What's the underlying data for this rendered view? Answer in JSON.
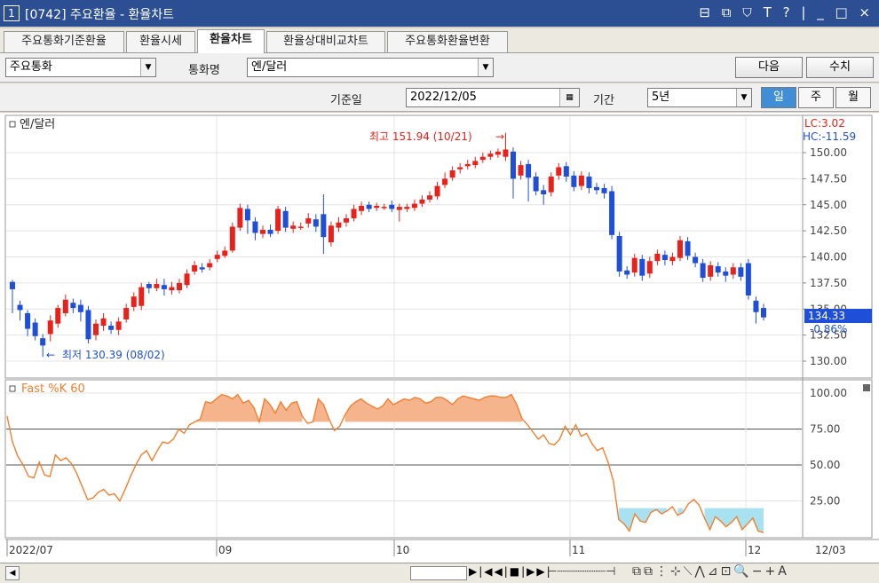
{
  "window": {
    "number": "1",
    "title": "[0742] 주요환율 - 환율차트",
    "controls": "⊟ ⧉ ⛉ T ? | _ □ ×"
  },
  "tabs": [
    "주요통화기준환율",
    "환율시세",
    "환율차트",
    "환율상대비교차트",
    "주요통화환율변환"
  ],
  "active_tab": "환율차트",
  "filters": {
    "group_value": "주요통화",
    "currency_label": "통화명",
    "currency_value": "엔/달러",
    "next_button": "다음",
    "refresh_button": "수치",
    "date_label": "기준일",
    "date_value": "2022/12/05",
    "period_label": "기간",
    "period_value": "5년",
    "day_button": "일",
    "week_button": "주",
    "month_button": "월"
  },
  "colors": {
    "up": "#e8221b",
    "down": "#1f4fd8",
    "fastk": "#f08030",
    "fill_high": "#f5b48c",
    "fill_low": "#a8e2f0",
    "current_badge": "#1f4fd8"
  },
  "price_panel": {
    "name": "엔/달러",
    "lc": "LC:3.02",
    "hc": "HC:-11.59",
    "high_note": "최고 151.94 (10/21)",
    "low_note": "최저 130.39 (08/02)",
    "current_value": "134.33",
    "current_change": "-0.86%",
    "y_ticks": [
      "150.00",
      "147.50",
      "145.00",
      "142.50",
      "140.00",
      "137.50",
      "135.00",
      "132.50",
      "130.00"
    ]
  },
  "osc_panel": {
    "name": "Fast %K 60",
    "y_ticks": [
      "100.00",
      "75.00",
      "50.00",
      "25.00"
    ]
  },
  "x_axis": {
    "labels": [
      "2022/07",
      "09",
      "10",
      "11",
      "12",
      "12/03"
    ]
  },
  "chart_data": {
    "type": "candlestick",
    "title": "엔/달러",
    "ylim": [
      129,
      152
    ],
    "candles": [
      {
        "o": 137.6,
        "c": 136.9,
        "h": 137.8,
        "l": 134.6,
        "up": false
      },
      {
        "o": 135.4,
        "c": 134.9,
        "h": 135.8,
        "l": 133.9,
        "up": false
      },
      {
        "o": 134.6,
        "c": 133.1,
        "h": 134.9,
        "l": 132.4,
        "up": false
      },
      {
        "o": 133.7,
        "c": 132.4,
        "h": 134.1,
        "l": 132.0,
        "up": false
      },
      {
        "o": 132.2,
        "c": 131.5,
        "h": 132.6,
        "l": 130.4,
        "up": false
      },
      {
        "o": 132.6,
        "c": 133.9,
        "h": 134.4,
        "l": 131.9,
        "up": true
      },
      {
        "o": 133.6,
        "c": 135.1,
        "h": 135.4,
        "l": 133.2,
        "up": true
      },
      {
        "o": 134.6,
        "c": 135.9,
        "h": 136.4,
        "l": 134.3,
        "up": true
      },
      {
        "o": 135.6,
        "c": 135.1,
        "h": 136.0,
        "l": 134.6,
        "up": false
      },
      {
        "o": 135.4,
        "c": 134.7,
        "h": 135.9,
        "l": 133.8,
        "up": false
      },
      {
        "o": 134.9,
        "c": 132.1,
        "h": 135.3,
        "l": 131.7,
        "up": false
      },
      {
        "o": 132.5,
        "c": 133.6,
        "h": 134.0,
        "l": 132.0,
        "up": true
      },
      {
        "o": 133.4,
        "c": 134.1,
        "h": 134.6,
        "l": 132.9,
        "up": true
      },
      {
        "o": 133.4,
        "c": 133.0,
        "h": 133.8,
        "l": 132.6,
        "up": false
      },
      {
        "o": 133.0,
        "c": 133.8,
        "h": 134.2,
        "l": 132.5,
        "up": true
      },
      {
        "o": 134.0,
        "c": 135.1,
        "h": 135.5,
        "l": 133.7,
        "up": true
      },
      {
        "o": 135.2,
        "c": 136.2,
        "h": 136.6,
        "l": 134.8,
        "up": true
      },
      {
        "o": 135.3,
        "c": 137.1,
        "h": 137.5,
        "l": 134.9,
        "up": true
      },
      {
        "o": 137.4,
        "c": 137.0,
        "h": 137.6,
        "l": 136.5,
        "up": false
      },
      {
        "o": 137.0,
        "c": 137.4,
        "h": 137.9,
        "l": 136.7,
        "up": true
      },
      {
        "o": 137.3,
        "c": 136.9,
        "h": 137.9,
        "l": 136.3,
        "up": false
      },
      {
        "o": 136.8,
        "c": 137.1,
        "h": 137.6,
        "l": 136.4,
        "up": true
      },
      {
        "o": 136.8,
        "c": 137.5,
        "h": 137.9,
        "l": 136.5,
        "up": true
      },
      {
        "o": 137.3,
        "c": 138.4,
        "h": 138.8,
        "l": 137.0,
        "up": true
      },
      {
        "o": 138.6,
        "c": 139.2,
        "h": 139.6,
        "l": 138.3,
        "up": true
      },
      {
        "o": 139.0,
        "c": 138.8,
        "h": 139.4,
        "l": 138.5,
        "up": false
      },
      {
        "o": 139.0,
        "c": 139.4,
        "h": 139.8,
        "l": 138.7,
        "up": true
      },
      {
        "o": 139.8,
        "c": 140.2,
        "h": 140.6,
        "l": 139.5,
        "up": true
      },
      {
        "o": 140.1,
        "c": 140.6,
        "h": 141.0,
        "l": 139.9,
        "up": true
      },
      {
        "o": 140.6,
        "c": 142.9,
        "h": 143.3,
        "l": 140.4,
        "up": true
      },
      {
        "o": 142.8,
        "c": 144.7,
        "h": 145.1,
        "l": 142.5,
        "up": true
      },
      {
        "o": 144.6,
        "c": 143.5,
        "h": 145.0,
        "l": 142.2,
        "up": false
      },
      {
        "o": 143.4,
        "c": 142.3,
        "h": 143.8,
        "l": 141.6,
        "up": false
      },
      {
        "o": 142.2,
        "c": 142.6,
        "h": 143.0,
        "l": 141.8,
        "up": true
      },
      {
        "o": 142.6,
        "c": 142.2,
        "h": 143.1,
        "l": 141.9,
        "up": false
      },
      {
        "o": 142.5,
        "c": 144.6,
        "h": 144.9,
        "l": 142.2,
        "up": true
      },
      {
        "o": 144.4,
        "c": 142.8,
        "h": 144.8,
        "l": 142.4,
        "up": false
      },
      {
        "o": 142.7,
        "c": 143.0,
        "h": 143.4,
        "l": 142.3,
        "up": true
      },
      {
        "o": 142.9,
        "c": 142.9,
        "h": 143.3,
        "l": 142.6,
        "up": true
      },
      {
        "o": 143.2,
        "c": 143.7,
        "h": 144.2,
        "l": 142.8,
        "up": true
      },
      {
        "o": 143.6,
        "c": 142.9,
        "h": 144.1,
        "l": 142.4,
        "up": false
      },
      {
        "o": 144.1,
        "c": 141.9,
        "h": 146.0,
        "l": 140.3,
        "up": false
      },
      {
        "o": 141.4,
        "c": 143.0,
        "h": 143.4,
        "l": 141.0,
        "up": true
      },
      {
        "o": 142.8,
        "c": 143.3,
        "h": 143.8,
        "l": 142.4,
        "up": true
      },
      {
        "o": 143.3,
        "c": 143.7,
        "h": 144.1,
        "l": 142.9,
        "up": true
      },
      {
        "o": 143.7,
        "c": 144.6,
        "h": 145.0,
        "l": 143.4,
        "up": true
      },
      {
        "o": 144.4,
        "c": 144.9,
        "h": 145.3,
        "l": 144.0,
        "up": true
      },
      {
        "o": 145.0,
        "c": 144.6,
        "h": 145.3,
        "l": 144.3,
        "up": false
      },
      {
        "o": 144.7,
        "c": 144.9,
        "h": 145.2,
        "l": 144.4,
        "up": true
      },
      {
        "o": 144.8,
        "c": 144.8,
        "h": 145.1,
        "l": 144.5,
        "up": true
      },
      {
        "o": 145.0,
        "c": 144.6,
        "h": 145.4,
        "l": 144.3,
        "up": false
      },
      {
        "o": 144.5,
        "c": 144.8,
        "h": 145.1,
        "l": 143.4,
        "up": true
      },
      {
        "o": 144.6,
        "c": 144.8,
        "h": 145.1,
        "l": 144.3,
        "up": true
      },
      {
        "o": 144.7,
        "c": 145.1,
        "h": 145.5,
        "l": 144.4,
        "up": true
      },
      {
        "o": 145.1,
        "c": 145.5,
        "h": 145.9,
        "l": 144.8,
        "up": true
      },
      {
        "o": 145.5,
        "c": 145.9,
        "h": 146.3,
        "l": 145.2,
        "up": true
      },
      {
        "o": 145.8,
        "c": 146.8,
        "h": 147.2,
        "l": 145.5,
        "up": true
      },
      {
        "o": 146.9,
        "c": 147.5,
        "h": 148.1,
        "l": 146.6,
        "up": true
      },
      {
        "o": 147.6,
        "c": 148.3,
        "h": 148.7,
        "l": 147.3,
        "up": true
      },
      {
        "o": 148.4,
        "c": 148.6,
        "h": 149.0,
        "l": 148.0,
        "up": true
      },
      {
        "o": 148.7,
        "c": 148.9,
        "h": 149.3,
        "l": 148.4,
        "up": true
      },
      {
        "o": 148.8,
        "c": 149.2,
        "h": 149.6,
        "l": 148.5,
        "up": true
      },
      {
        "o": 149.3,
        "c": 149.6,
        "h": 150.0,
        "l": 149.0,
        "up": true
      },
      {
        "o": 149.6,
        "c": 149.9,
        "h": 150.2,
        "l": 149.3,
        "up": true
      },
      {
        "o": 149.8,
        "c": 150.1,
        "h": 150.4,
        "l": 149.5,
        "up": true
      },
      {
        "o": 150.3,
        "c": 149.6,
        "h": 151.9,
        "l": 149.2,
        "up": true
      },
      {
        "o": 150.1,
        "c": 147.5,
        "h": 150.5,
        "l": 145.6,
        "up": false
      },
      {
        "o": 147.8,
        "c": 148.8,
        "h": 149.2,
        "l": 147.4,
        "up": true
      },
      {
        "o": 148.9,
        "c": 147.6,
        "h": 149.3,
        "l": 145.3,
        "up": false
      },
      {
        "o": 147.7,
        "c": 146.3,
        "h": 148.1,
        "l": 145.9,
        "up": false
      },
      {
        "o": 146.4,
        "c": 146.0,
        "h": 146.9,
        "l": 145.0,
        "up": false
      },
      {
        "o": 146.2,
        "c": 147.7,
        "h": 148.1,
        "l": 145.8,
        "up": true
      },
      {
        "o": 147.8,
        "c": 148.6,
        "h": 149.0,
        "l": 147.4,
        "up": true
      },
      {
        "o": 148.7,
        "c": 147.7,
        "h": 149.1,
        "l": 147.2,
        "up": false
      },
      {
        "o": 147.8,
        "c": 146.7,
        "h": 148.2,
        "l": 146.3,
        "up": false
      },
      {
        "o": 146.8,
        "c": 147.8,
        "h": 148.2,
        "l": 146.4,
        "up": true
      },
      {
        "o": 147.7,
        "c": 146.6,
        "h": 148.1,
        "l": 146.1,
        "up": false
      },
      {
        "o": 146.7,
        "c": 146.4,
        "h": 147.1,
        "l": 146.0,
        "up": false
      },
      {
        "o": 146.6,
        "c": 146.1,
        "h": 147.0,
        "l": 145.6,
        "up": false
      },
      {
        "o": 146.3,
        "c": 142.1,
        "h": 146.8,
        "l": 141.7,
        "up": false
      },
      {
        "o": 142.0,
        "c": 138.6,
        "h": 142.4,
        "l": 138.1,
        "up": false
      },
      {
        "o": 138.7,
        "c": 138.3,
        "h": 139.1,
        "l": 137.9,
        "up": false
      },
      {
        "o": 138.5,
        "c": 139.9,
        "h": 140.3,
        "l": 138.1,
        "up": true
      },
      {
        "o": 139.8,
        "c": 138.2,
        "h": 140.2,
        "l": 137.7,
        "up": false
      },
      {
        "o": 138.4,
        "c": 139.6,
        "h": 140.0,
        "l": 138.0,
        "up": true
      },
      {
        "o": 139.6,
        "c": 140.3,
        "h": 140.7,
        "l": 139.2,
        "up": true
      },
      {
        "o": 140.2,
        "c": 139.7,
        "h": 140.6,
        "l": 139.2,
        "up": false
      },
      {
        "o": 139.6,
        "c": 140.0,
        "h": 140.4,
        "l": 139.2,
        "up": true
      },
      {
        "o": 139.9,
        "c": 141.6,
        "h": 142.0,
        "l": 139.6,
        "up": true
      },
      {
        "o": 141.5,
        "c": 140.1,
        "h": 141.9,
        "l": 139.7,
        "up": false
      },
      {
        "o": 140.0,
        "c": 139.4,
        "h": 140.4,
        "l": 139.0,
        "up": false
      },
      {
        "o": 139.4,
        "c": 138.0,
        "h": 139.8,
        "l": 137.6,
        "up": false
      },
      {
        "o": 138.1,
        "c": 139.2,
        "h": 139.6,
        "l": 137.7,
        "up": true
      },
      {
        "o": 139.1,
        "c": 138.5,
        "h": 139.5,
        "l": 138.1,
        "up": false
      },
      {
        "o": 138.6,
        "c": 138.2,
        "h": 139.0,
        "l": 137.6,
        "up": false
      },
      {
        "o": 138.3,
        "c": 139.0,
        "h": 139.4,
        "l": 137.9,
        "up": true
      },
      {
        "o": 139.0,
        "c": 138.1,
        "h": 139.4,
        "l": 137.7,
        "up": false
      },
      {
        "o": 139.4,
        "c": 136.3,
        "h": 139.8,
        "l": 135.9,
        "up": false
      },
      {
        "o": 135.8,
        "c": 134.7,
        "h": 136.2,
        "l": 133.6,
        "up": false
      },
      {
        "o": 135.1,
        "c": 134.2,
        "h": 135.5,
        "l": 133.9,
        "up": false
      }
    ],
    "fastk": [
      84,
      66,
      56,
      50,
      42,
      41,
      52,
      43,
      42,
      57,
      53,
      55,
      51,
      44,
      35,
      26,
      27,
      31,
      33,
      29,
      30,
      25,
      33,
      42,
      50,
      57,
      60,
      53,
      60,
      66,
      65,
      68,
      75,
      72,
      78,
      80,
      82,
      94,
      93,
      96,
      99,
      98,
      96,
      99,
      93,
      95,
      90,
      80,
      96,
      92,
      86,
      94,
      88,
      93,
      94,
      84,
      79,
      80,
      96,
      92,
      82,
      74,
      77,
      85,
      91,
      94,
      96,
      93,
      91,
      89,
      91,
      96,
      92,
      94,
      96,
      95,
      97,
      96,
      93,
      94,
      97,
      97,
      95,
      92,
      96,
      98,
      97,
      96,
      95,
      97,
      98,
      98,
      97,
      97,
      99,
      92,
      82,
      78,
      73,
      68,
      71,
      65,
      64,
      68,
      77,
      71,
      78,
      70,
      72,
      65,
      60,
      62,
      52,
      39,
      12,
      9,
      4,
      16,
      11,
      10,
      17,
      19,
      16,
      18,
      21,
      15,
      17,
      23,
      26,
      22,
      13,
      5,
      14,
      11,
      7,
      10,
      14,
      5,
      9,
      13,
      4,
      3
    ]
  }
}
